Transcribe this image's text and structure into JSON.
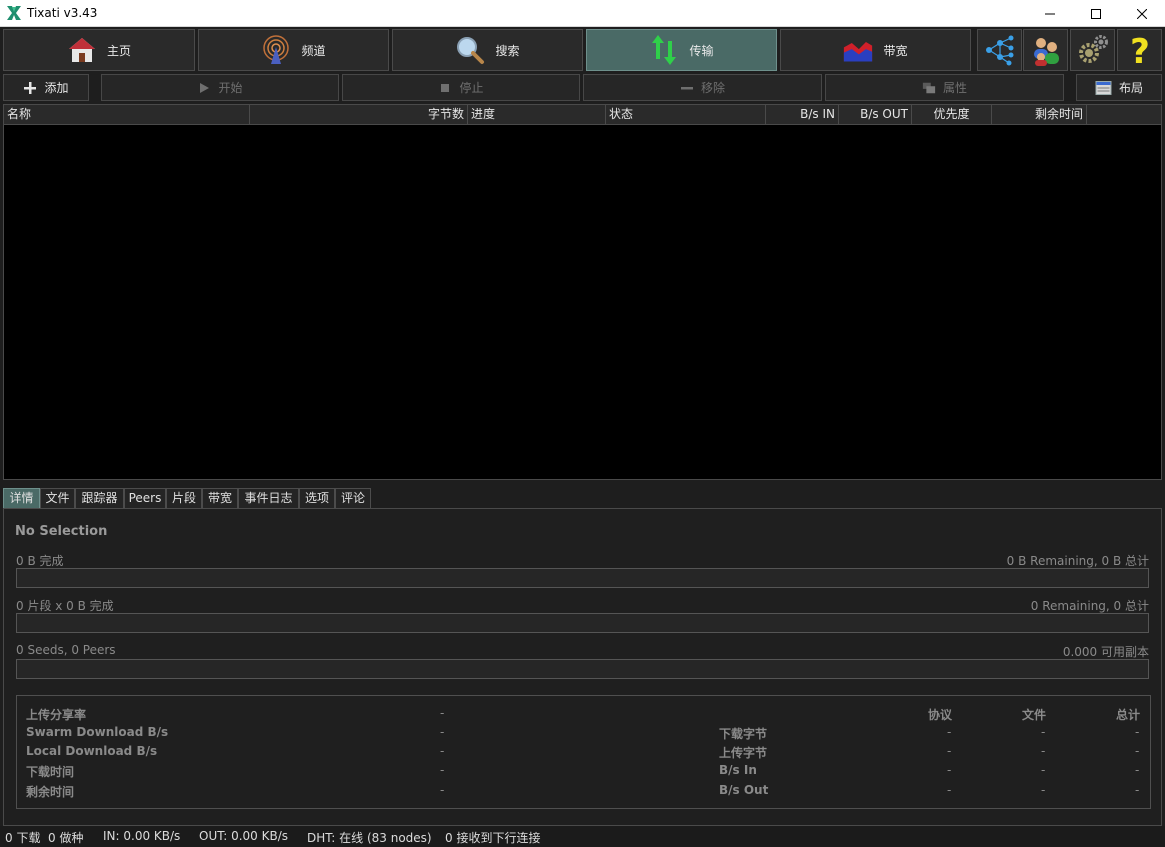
{
  "window": {
    "title": "Tixati v3.43"
  },
  "toolbar": {
    "home": "主页",
    "channels": "频道",
    "search": "搜索",
    "transfers": "传输",
    "bandwidth": "带宽"
  },
  "actions": {
    "add": "添加",
    "start": "开始",
    "stop": "停止",
    "remove": "移除",
    "properties": "属性",
    "layout": "布局"
  },
  "columns": [
    "名称",
    "字节数",
    "进度",
    "状态",
    "B/s IN",
    "B/s OUT",
    "优先度",
    "剩余时间"
  ],
  "tabs": [
    "详情",
    "文件",
    "跟踪器",
    "Peers",
    "片段",
    "带宽",
    "事件日志",
    "选项",
    "评论"
  ],
  "details": {
    "heading": "No Selection",
    "complete_left": "0 B 完成",
    "complete_right": "0 B Remaining,  0 B 总计",
    "pieces_left": "0 片段  x  0 B 完成",
    "pieces_right": "0 Remaining,  0 总计",
    "seeds_left": "0 Seeds, 0 Peers",
    "seeds_right": "0.000 可用副本",
    "left_labels": [
      "上传分享率",
      "Swarm Download B/s",
      "Local Download B/s",
      "下载时间",
      "剩余时间"
    ],
    "left_values": [
      "-",
      "-",
      "-",
      "-",
      "-"
    ],
    "right_headers": [
      "协议",
      "文件",
      "总计"
    ],
    "right_labels": [
      "下载字节",
      "上传字节",
      "B/s In",
      "B/s Out"
    ],
    "dash": "-"
  },
  "status": {
    "downloads": "0 下载",
    "seeds": "0 做种",
    "in": "IN: 0.00 KB/s",
    "out": "OUT: 0.00 KB/s",
    "dht": "DHT: 在线 (83 nodes)",
    "incoming": "0 接收到下行连接"
  },
  "colors": {
    "accent_active": "#4a6a66",
    "background": "#1e1e1e",
    "list_bg": "#000000"
  }
}
